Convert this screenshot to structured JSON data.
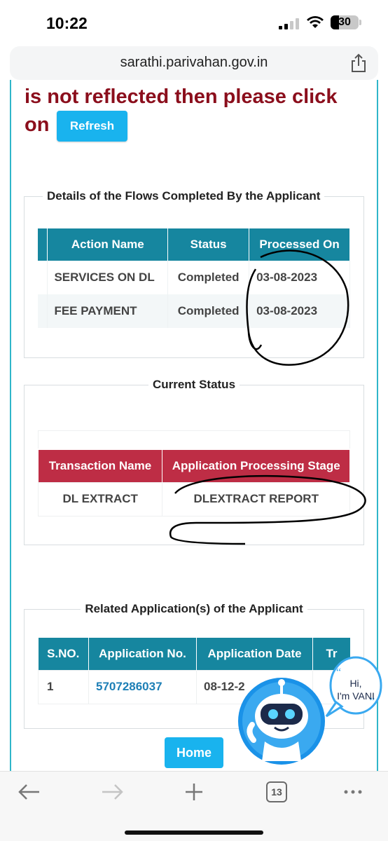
{
  "status_bar": {
    "time": "10:22",
    "battery": "30"
  },
  "browser": {
    "url": "sarathi.parivahan.gov.in",
    "tab_count": "13"
  },
  "notice": {
    "line1": "is not reflected then please click",
    "line2": "on",
    "refresh_label": "Refresh"
  },
  "flows": {
    "legend": "Details of the Flows Completed By the Applicant",
    "headers": [
      "Action Name",
      "Status",
      "Processed On"
    ],
    "rows": [
      [
        "SERVICES ON DL",
        "Completed",
        "03-08-2023"
      ],
      [
        "FEE PAYMENT",
        "Completed",
        "03-08-2023"
      ]
    ]
  },
  "current_status": {
    "legend": "Current Status",
    "headers": [
      "Transaction Name",
      "Application Processing Stage"
    ],
    "rows": [
      [
        "DL EXTRACT",
        "DLEXTRACT REPORT"
      ]
    ]
  },
  "related": {
    "legend": "Related Application(s) of the Applicant",
    "headers": [
      "S.NO.",
      "Application No.",
      "Application Date",
      "Tr"
    ],
    "rows": [
      [
        "1",
        "5707286037",
        "08-12-2",
        ""
      ]
    ]
  },
  "home_label": "Home",
  "vani": {
    "greeting1": "Hi,",
    "greeting2": "I'm VANI"
  },
  "colors": {
    "teal_header": "#16869f",
    "red_header": "#be2d45",
    "button": "#19b3ee",
    "notice": "#8b0e1c"
  }
}
